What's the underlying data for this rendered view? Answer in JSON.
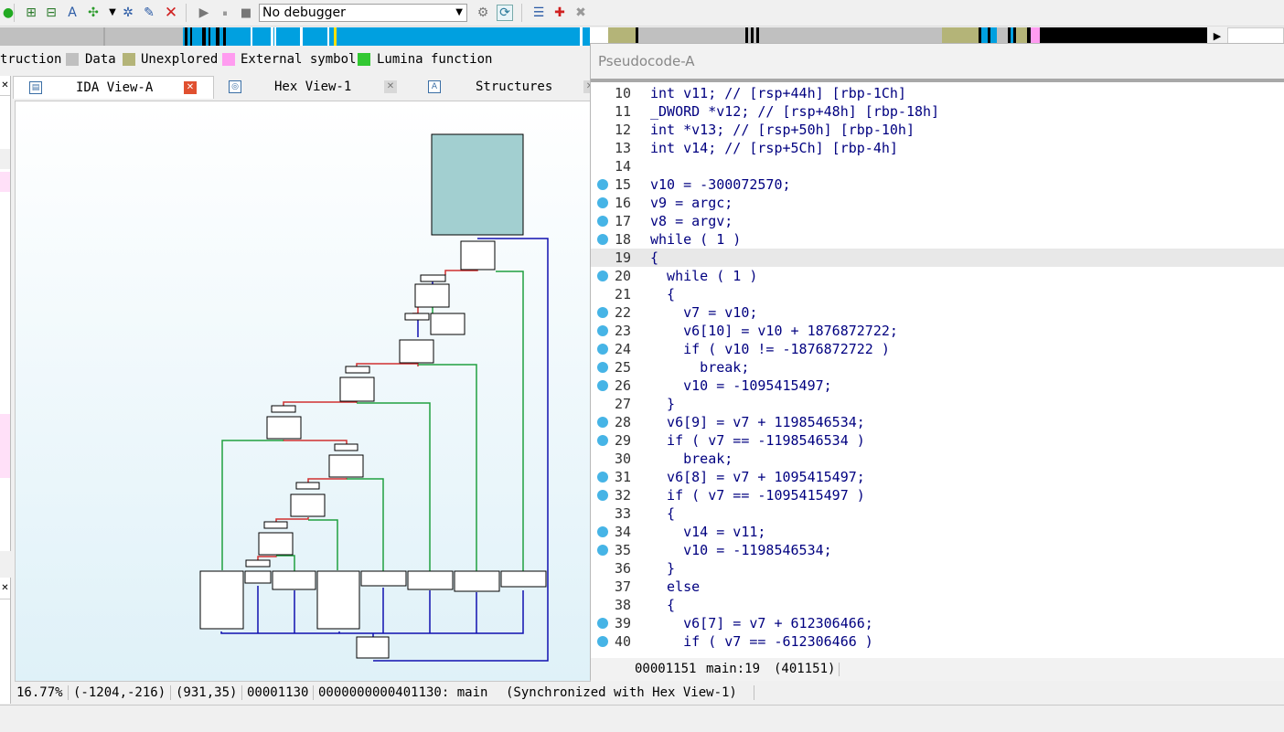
{
  "toolbar": {
    "debugger_value": "No debugger",
    "icons": [
      "add-code-icon",
      "add-data-icon",
      "add-string-icon",
      "add-struct-icon",
      "dropdown-icon",
      "add-enum-icon",
      "edit-icon",
      "delete-icon",
      "run-icon",
      "pause-icon",
      "stop-icon",
      "attach-icon",
      "sync-icon",
      "list-icon",
      "add-breakpoint-icon",
      "remove-breakpoint-icon"
    ]
  },
  "legend": {
    "items": [
      {
        "label": "truction",
        "color": "#000000"
      },
      {
        "label": "Data",
        "color": "#c0c0c0"
      },
      {
        "label": "Unexplored",
        "color": "#b4b478"
      },
      {
        "label": "External symbol",
        "color": "#ff9cf0"
      },
      {
        "label": "Lumina function",
        "color": "#32c832"
      }
    ]
  },
  "tabs": [
    {
      "label": "IDA View-A",
      "active": true
    },
    {
      "label": "Hex View-1",
      "active": false
    },
    {
      "label": "Structures",
      "active": false
    }
  ],
  "status": {
    "zoom": "16.77%",
    "coords1": "(-1204,-216)",
    "coords2": "(931,35)",
    "offset": "00001130",
    "address": "0000000000401130: main",
    "sync": "(Synchronized with Hex View-1)"
  },
  "pseudocode": {
    "title": "Pseudocode-A",
    "lines": [
      {
        "num": "10",
        "text": "int v11; // [rsp+44h] [rbp-1Ch]",
        "bp": false
      },
      {
        "num": "11",
        "text": "_DWORD *v12; // [rsp+48h] [rbp-18h]",
        "bp": false
      },
      {
        "num": "12",
        "text": "int *v13; // [rsp+50h] [rbp-10h]",
        "bp": false
      },
      {
        "num": "13",
        "text": "int v14; // [rsp+5Ch] [rbp-4h]",
        "bp": false
      },
      {
        "num": "14",
        "text": "",
        "bp": false
      },
      {
        "num": "15",
        "text": "v10 = -300072570;",
        "bp": true
      },
      {
        "num": "16",
        "text": "v9 = argc;",
        "bp": true
      },
      {
        "num": "17",
        "text": "v8 = argv;",
        "bp": true
      },
      {
        "num": "18",
        "text": "while ( 1 )",
        "bp": true
      },
      {
        "num": "19",
        "text": "{",
        "bp": false,
        "hl": true
      },
      {
        "num": "20",
        "text": "  while ( 1 )",
        "bp": true
      },
      {
        "num": "21",
        "text": "  {",
        "bp": false
      },
      {
        "num": "22",
        "text": "    v7 = v10;",
        "bp": true
      },
      {
        "num": "23",
        "text": "    v6[10] = v10 + 1876872722;",
        "bp": true
      },
      {
        "num": "24",
        "text": "    if ( v10 != -1876872722 )",
        "bp": true
      },
      {
        "num": "25",
        "text": "      break;",
        "bp": true
      },
      {
        "num": "26",
        "text": "    v10 = -1095415497;",
        "bp": true
      },
      {
        "num": "27",
        "text": "  }",
        "bp": false
      },
      {
        "num": "28",
        "text": "  v6[9] = v7 + 1198546534;",
        "bp": true
      },
      {
        "num": "29",
        "text": "  if ( v7 == -1198546534 )",
        "bp": true
      },
      {
        "num": "30",
        "text": "    break;",
        "bp": false
      },
      {
        "num": "31",
        "text": "  v6[8] = v7 + 1095415497;",
        "bp": true
      },
      {
        "num": "32",
        "text": "  if ( v7 == -1095415497 )",
        "bp": true
      },
      {
        "num": "33",
        "text": "  {",
        "bp": false
      },
      {
        "num": "34",
        "text": "    v14 = v11;",
        "bp": true
      },
      {
        "num": "35",
        "text": "    v10 = -1198546534;",
        "bp": true
      },
      {
        "num": "36",
        "text": "  }",
        "bp": false
      },
      {
        "num": "37",
        "text": "  else",
        "bp": false
      },
      {
        "num": "38",
        "text": "  {",
        "bp": false
      },
      {
        "num": "39",
        "text": "    v6[7] = v7 + 612306466;",
        "bp": true
      },
      {
        "num": "40",
        "text": "    if ( v7 == -612306466 )",
        "bp": true
      }
    ],
    "status_offset": "00001151",
    "status_location": "main:19",
    "status_address": "(401151)"
  }
}
